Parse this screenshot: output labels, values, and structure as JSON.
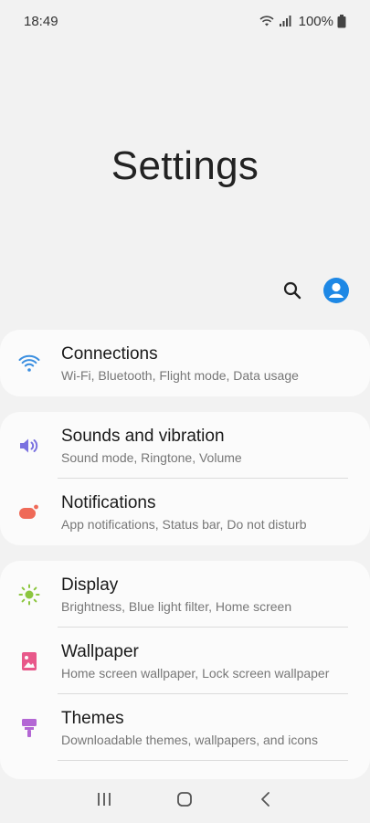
{
  "status_bar": {
    "time": "18:49",
    "battery": "100%",
    "icons": [
      "wifi-icon",
      "signal-icon",
      "battery-icon"
    ]
  },
  "header": {
    "title": "Settings",
    "actions": [
      "search-icon",
      "account-icon"
    ],
    "accent": "#1e88e5"
  },
  "groups": [
    {
      "items": [
        {
          "icon": "wifi-icon",
          "color": "#3b8fe0",
          "title": "Connections",
          "subtitle": "Wi-Fi, Bluetooth, Flight mode, Data usage"
        }
      ]
    },
    {
      "items": [
        {
          "icon": "volume-icon",
          "color": "#7b72e0",
          "title": "Sounds and vibration",
          "subtitle": "Sound mode, Ringtone, Volume"
        },
        {
          "icon": "notification-icon",
          "color": "#ef6a58",
          "title": "Notifications",
          "subtitle": "App notifications, Status bar, Do not disturb"
        }
      ]
    },
    {
      "items": [
        {
          "icon": "brightness-icon",
          "color": "#8cc63f",
          "title": "Display",
          "subtitle": "Brightness, Blue light filter, Home screen"
        },
        {
          "icon": "wallpaper-icon",
          "color": "#e8588a",
          "title": "Wallpaper",
          "subtitle": "Home screen wallpaper, Lock screen wallpaper"
        },
        {
          "icon": "themes-icon",
          "color": "#b366d4",
          "title": "Themes",
          "subtitle": "Downloadable themes, wallpapers, and icons"
        }
      ]
    }
  ],
  "nav_bar": {
    "buttons": [
      "recents-icon",
      "home-icon",
      "back-icon"
    ]
  }
}
